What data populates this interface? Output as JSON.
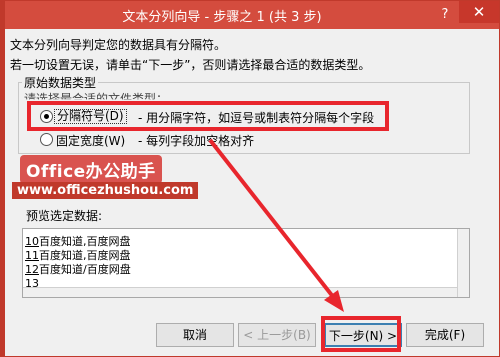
{
  "window": {
    "title": "文本分列向导 - 步骤之 1 (共 3 步)",
    "help_label": "?",
    "close_label": "✕"
  },
  "intro": {
    "line1": "文本分列向导判定您的数据具有分隔符。",
    "line2": "若一切设置无误，请单击“下一步”，否则请选择最合适的数据类型。"
  },
  "file_type": {
    "group_label": "原始数据类型",
    "sub_label": "请选择最合适的文件类型：",
    "options": [
      {
        "label": "分隔符号(D)",
        "desc": "- 用分隔字符，如逗号或制表符分隔每个字段",
        "selected": true
      },
      {
        "label": "固定宽度(W)",
        "desc": "- 每列字段加空格对齐",
        "selected": false
      }
    ]
  },
  "watermark": {
    "brand": "Office办公助手",
    "url": "www.officezhushou.com"
  },
  "preview": {
    "label": "预览选定数据:",
    "rows": [
      {
        "num": "10",
        "text": "百度知道,百度网盘"
      },
      {
        "num": "11",
        "text": "百度知道,百度网盘"
      },
      {
        "num": "12",
        "text": "百度知道/百度网盘"
      },
      {
        "num": "13",
        "text": ""
      }
    ]
  },
  "buttons": {
    "cancel": "取消",
    "back": "< 上一步(B)",
    "next": "下一步(N) >",
    "finish": "完成(F)"
  },
  "colors": {
    "titlebar": "#d44c3e",
    "highlight": "#e8262d",
    "background": "#c0392b"
  }
}
